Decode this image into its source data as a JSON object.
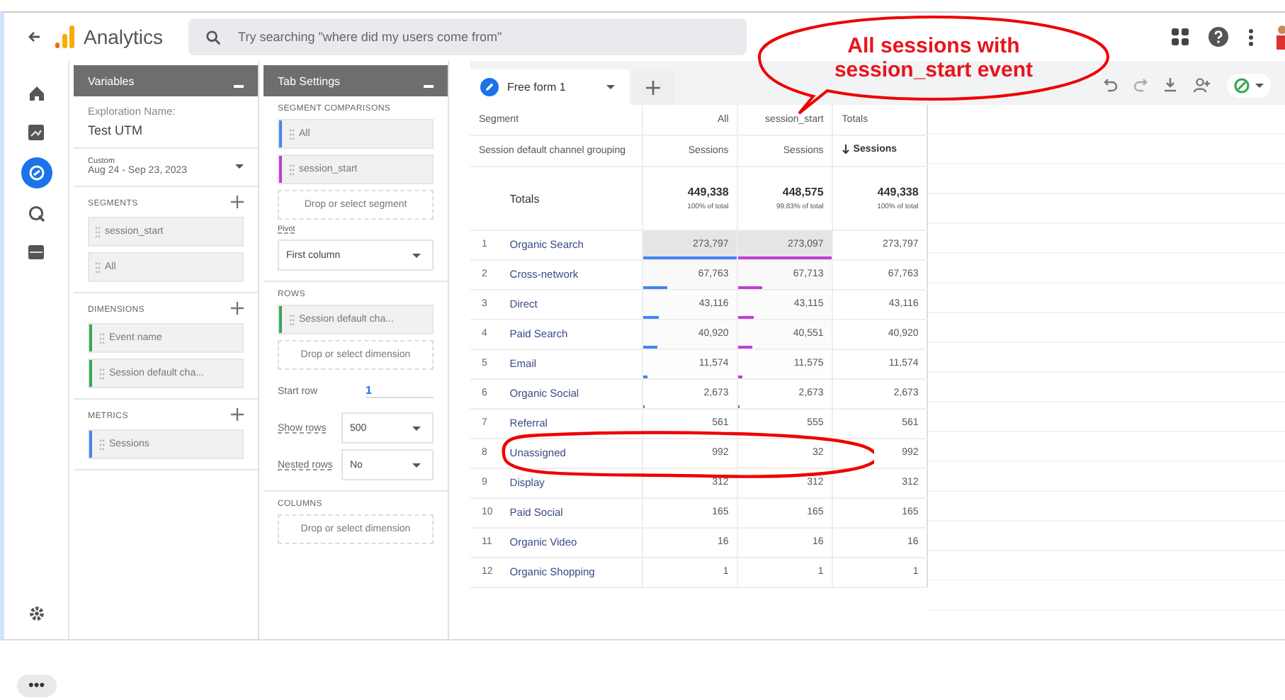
{
  "app": {
    "title": "Analytics",
    "search": {
      "placeholder": "Try searching \"where did my users come from\""
    }
  },
  "rail": {
    "items": [
      {
        "kind": "home",
        "selected": false
      },
      {
        "kind": "reports",
        "selected": false
      },
      {
        "kind": "explore",
        "selected": true
      },
      {
        "kind": "advertising",
        "selected": false
      },
      {
        "kind": "library",
        "selected": false
      }
    ]
  },
  "variables": {
    "title": "Variables",
    "name_label": "Exploration Name:",
    "name": "Test UTM",
    "date_label": "Custom",
    "date": "Aug 24 - Sep 23, 2023",
    "sections": [
      {
        "title": "SEGMENTS",
        "chips": [
          {
            "label": "session_start"
          },
          {
            "label": "All"
          }
        ]
      },
      {
        "title": "DIMENSIONS",
        "chips": [
          {
            "label": "Event name",
            "color": "#34a853"
          },
          {
            "label": "Session default cha...",
            "color": "#34a853"
          }
        ]
      },
      {
        "title": "METRICS",
        "chips": [
          {
            "label": "Sessions",
            "color": "#4285f4"
          }
        ]
      }
    ]
  },
  "tab_settings": {
    "title": "Tab Settings",
    "segment_title": "SEGMENT COMPARISONS",
    "segments": [
      {
        "label": "All",
        "color": "#4285f4"
      },
      {
        "label": "session_start",
        "color": "#c03fd6"
      }
    ],
    "segment_drop": "Drop or select segment",
    "pivot_label": "Pivot",
    "pivot": "First column",
    "rows_title": "ROWS",
    "rows": [
      {
        "label": "Session default cha...",
        "color": "#34a853"
      }
    ],
    "rows_drop": "Drop or select dimension",
    "start_row_label": "Start row",
    "start_row": "1",
    "show_rows_label": "Show rows",
    "show_rows": "500",
    "nested_rows_label": "Nested rows",
    "nested_rows": "No",
    "columns_title": "COLUMNS",
    "columns_drop": "Drop or select dimension"
  },
  "tabs": [
    {
      "label": "Free form 1",
      "selected": true
    }
  ],
  "table": {
    "segment_label": "Segment",
    "dimension_label": "Session default channel grouping",
    "totals_label": "Totals",
    "columns": [
      {
        "segment": "All",
        "metric": "Sessions",
        "total": "449,338",
        "share": "100% of total",
        "color": "#4285f4"
      },
      {
        "segment": "session_start",
        "metric": "Sessions",
        "total": "448,575",
        "share": "99.83% of total",
        "color": "#c03fd6"
      },
      {
        "segment": "Totals",
        "metric": "Sessions",
        "total": "449,338",
        "share": "100% of total"
      }
    ],
    "rows": [
      {
        "index": "1",
        "channel": "Organic Search",
        "cells": [
          {
            "value": "273,797",
            "level": 1
          },
          {
            "value": "273,097",
            "level": 1
          },
          {
            "value": "273,797"
          }
        ]
      },
      {
        "index": "2",
        "channel": "Cross-network",
        "cells": [
          {
            "value": "67,763",
            "level": 0.25
          },
          {
            "value": "67,713",
            "level": 0.25
          },
          {
            "value": "67,763"
          }
        ]
      },
      {
        "index": "3",
        "channel": "Direct",
        "cells": [
          {
            "value": "43,116",
            "level": 0.16
          },
          {
            "value": "43,115",
            "level": 0.16
          },
          {
            "value": "43,116"
          }
        ]
      },
      {
        "index": "4",
        "channel": "Paid Search",
        "cells": [
          {
            "value": "40,920",
            "level": 0.15
          },
          {
            "value": "40,551",
            "level": 0.15
          },
          {
            "value": "40,920"
          }
        ]
      },
      {
        "index": "5",
        "channel": "Email",
        "cells": [
          {
            "value": "11,574",
            "level": 0.04
          },
          {
            "value": "11,575",
            "level": 0.04
          },
          {
            "value": "11,574"
          }
        ]
      },
      {
        "index": "6",
        "channel": "Organic Social",
        "cells": [
          {
            "value": "2,673",
            "level": 0.01
          },
          {
            "value": "2,673",
            "level": 0.01
          },
          {
            "value": "2,673"
          }
        ]
      },
      {
        "index": "7",
        "channel": "Referral",
        "cells": [
          {
            "value": "561"
          },
          {
            "value": "555"
          },
          {
            "value": "561"
          }
        ]
      },
      {
        "index": "8",
        "channel": "Unassigned",
        "cells": [
          {
            "value": "992"
          },
          {
            "value": "32"
          },
          {
            "value": "992"
          }
        ]
      },
      {
        "index": "9",
        "channel": "Display",
        "cells": [
          {
            "value": "312"
          },
          {
            "value": "312"
          },
          {
            "value": "312"
          }
        ]
      },
      {
        "index": "10",
        "channel": "Paid Social",
        "cells": [
          {
            "value": "165"
          },
          {
            "value": "165"
          },
          {
            "value": "165"
          }
        ]
      },
      {
        "index": "11",
        "channel": "Organic Video",
        "cells": [
          {
            "value": "16"
          },
          {
            "value": "16"
          },
          {
            "value": "16"
          }
        ]
      },
      {
        "index": "12",
        "channel": "Organic Shopping",
        "cells": [
          {
            "value": "1"
          },
          {
            "value": "1"
          },
          {
            "value": "1"
          }
        ]
      }
    ]
  },
  "annotation": {
    "text": "All sessions with session_start event"
  },
  "more_button": "•••"
}
